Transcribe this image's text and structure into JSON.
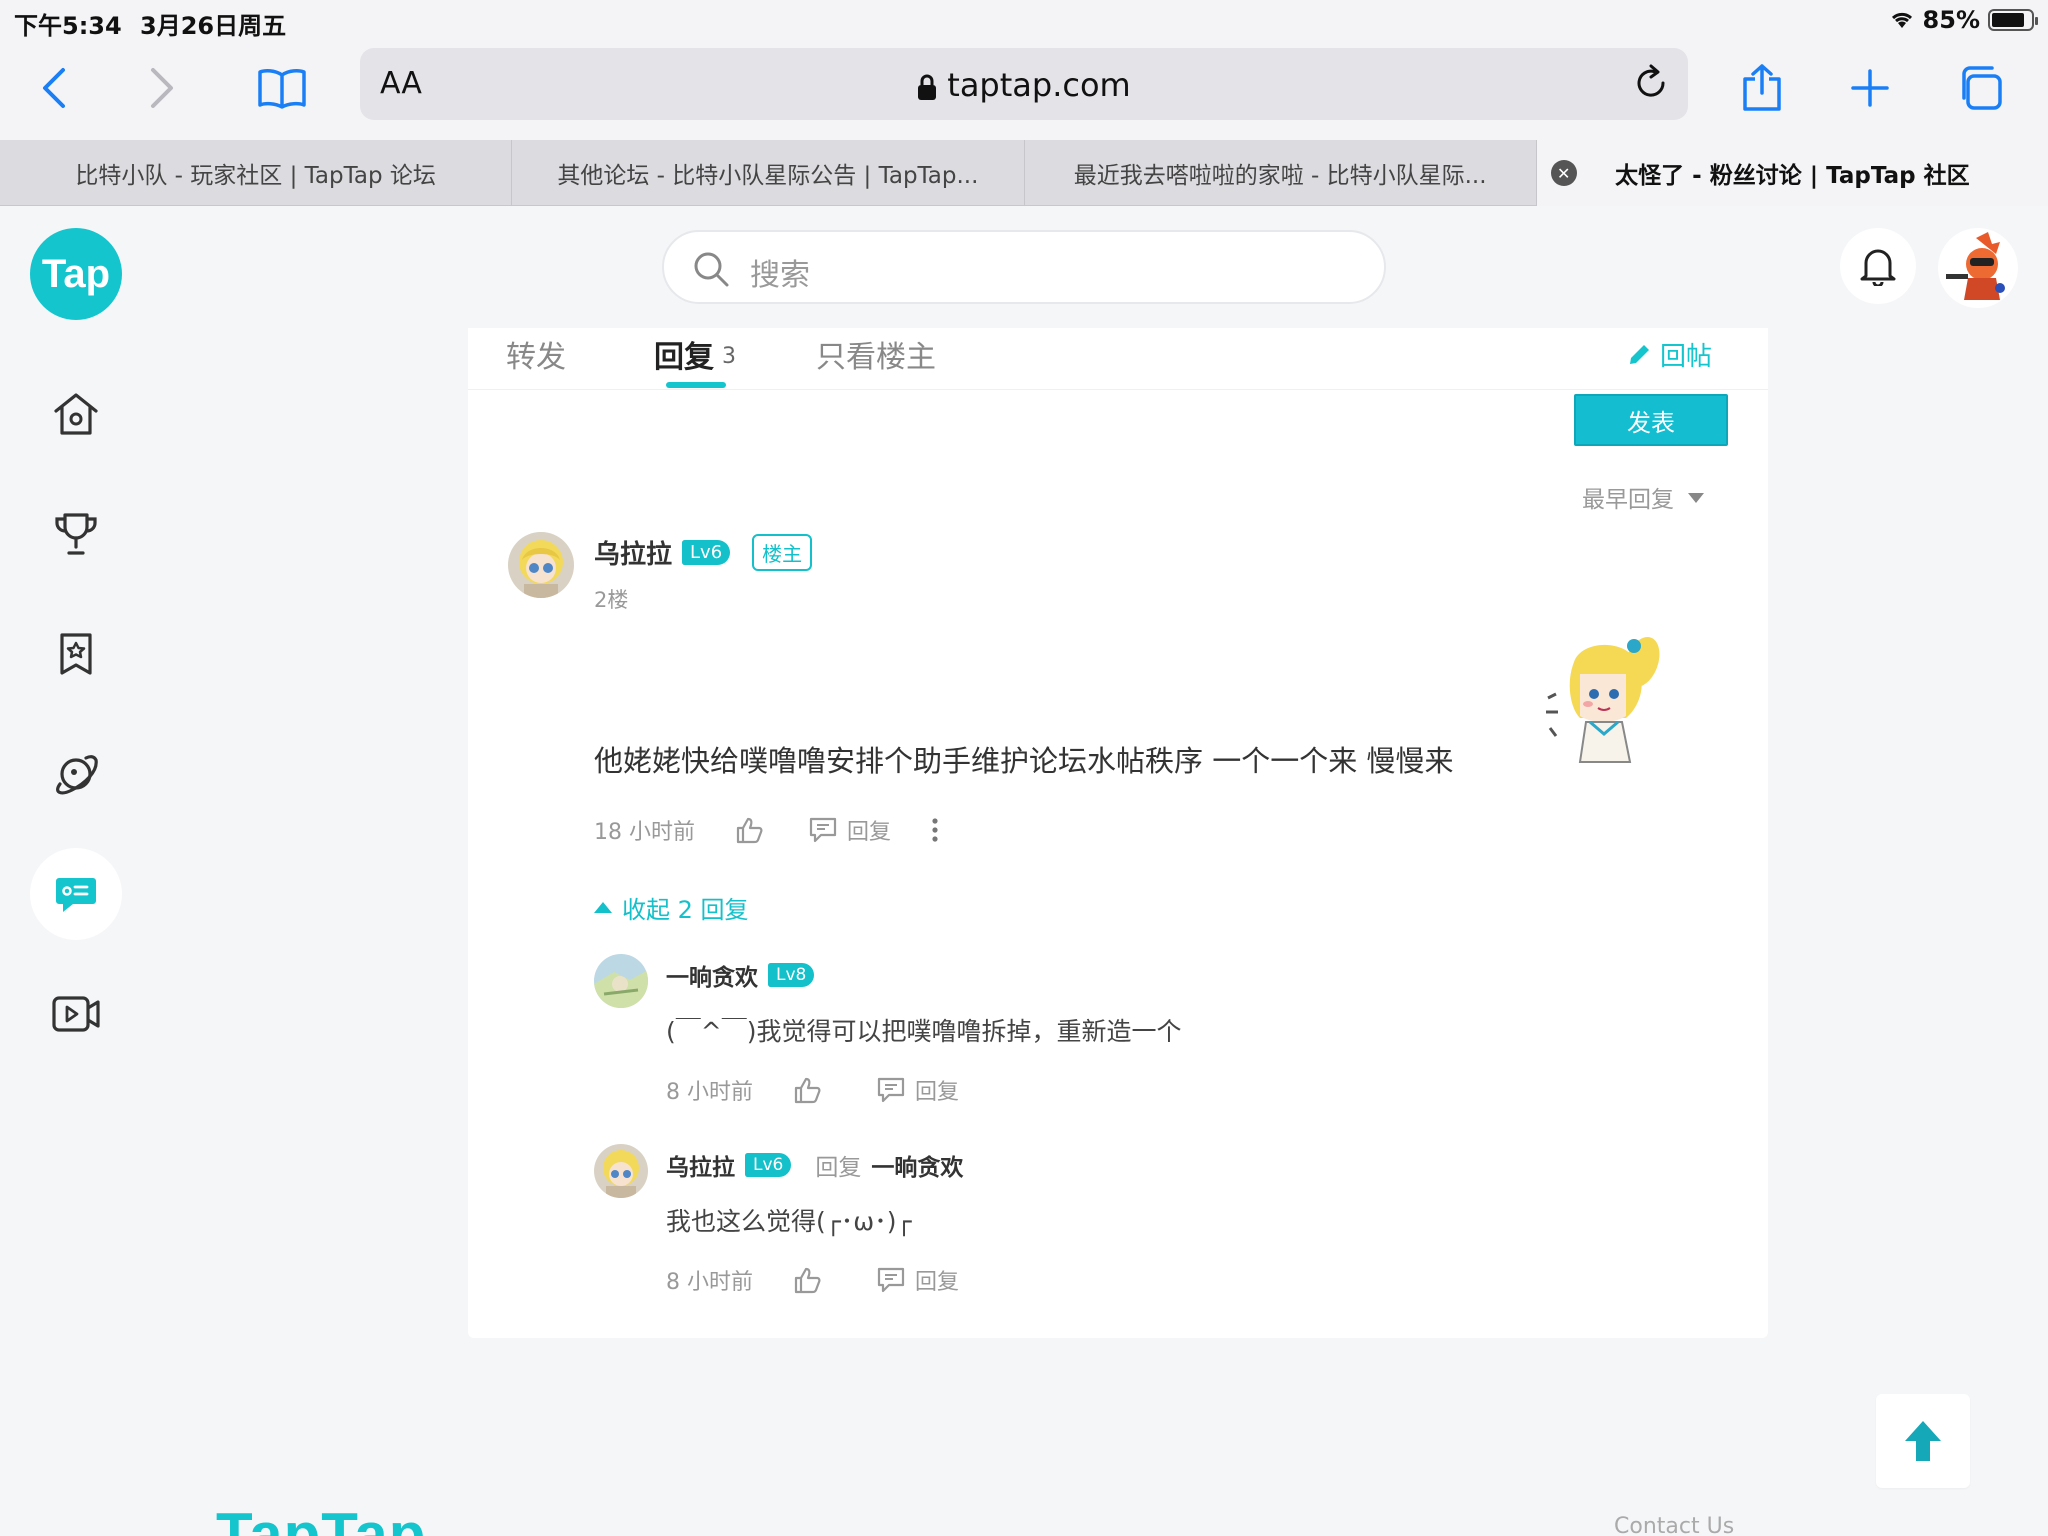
{
  "status": {
    "time": "下午5:34",
    "date": "3月26日周五",
    "battery": "85%",
    "battery_level": 0.85
  },
  "browser": {
    "url": "taptap.com",
    "aa": "AA",
    "tabs": [
      {
        "title": "比特小队 - 玩家社区 | TapTap 论坛"
      },
      {
        "title": "其他论坛 - 比特小队星际公告 | TapTap..."
      },
      {
        "title": "最近我去嗒啦啦的家啦 - 比特小队星际..."
      },
      {
        "title": "太怪了 - 粉丝讨论 | TapTap 社区",
        "active": true
      }
    ]
  },
  "site": {
    "logo_text": "Tap",
    "search_placeholder": "搜索",
    "accent": "#15c5ce"
  },
  "card": {
    "tabs": {
      "repost": "转发",
      "reply": "回复",
      "reply_count": "3",
      "op_only": "只看楼主"
    },
    "reply_post": "回帖",
    "publish": "发表",
    "sort": "最早回复"
  },
  "post": {
    "author": "乌拉拉",
    "level": "Lv6",
    "owner_badge": "楼主",
    "floor": "2楼",
    "content": "他姥姥快给噗噜噜安排个助手维护论坛水帖秩序 一个一个来 慢慢来",
    "time": "18 小时前",
    "reply_label": "回复",
    "collapse": "收起 2 回复"
  },
  "replies": [
    {
      "author": "一晌贪欢",
      "level": "Lv8",
      "content": "(￣^￣)我觉得可以把噗噜噜拆掉，重新造一个",
      "time": "8 小时前",
      "reply_label": "回复"
    },
    {
      "author": "乌拉拉",
      "level": "Lv6",
      "reply_word": "回复",
      "reply_to": "一晌贪欢",
      "content": "我也这么觉得(┌･ω･)┌",
      "time": "8 小时前",
      "reply_label": "回复"
    }
  ],
  "footer": {
    "logo": "TapTap",
    "contact": "Contact Us"
  }
}
